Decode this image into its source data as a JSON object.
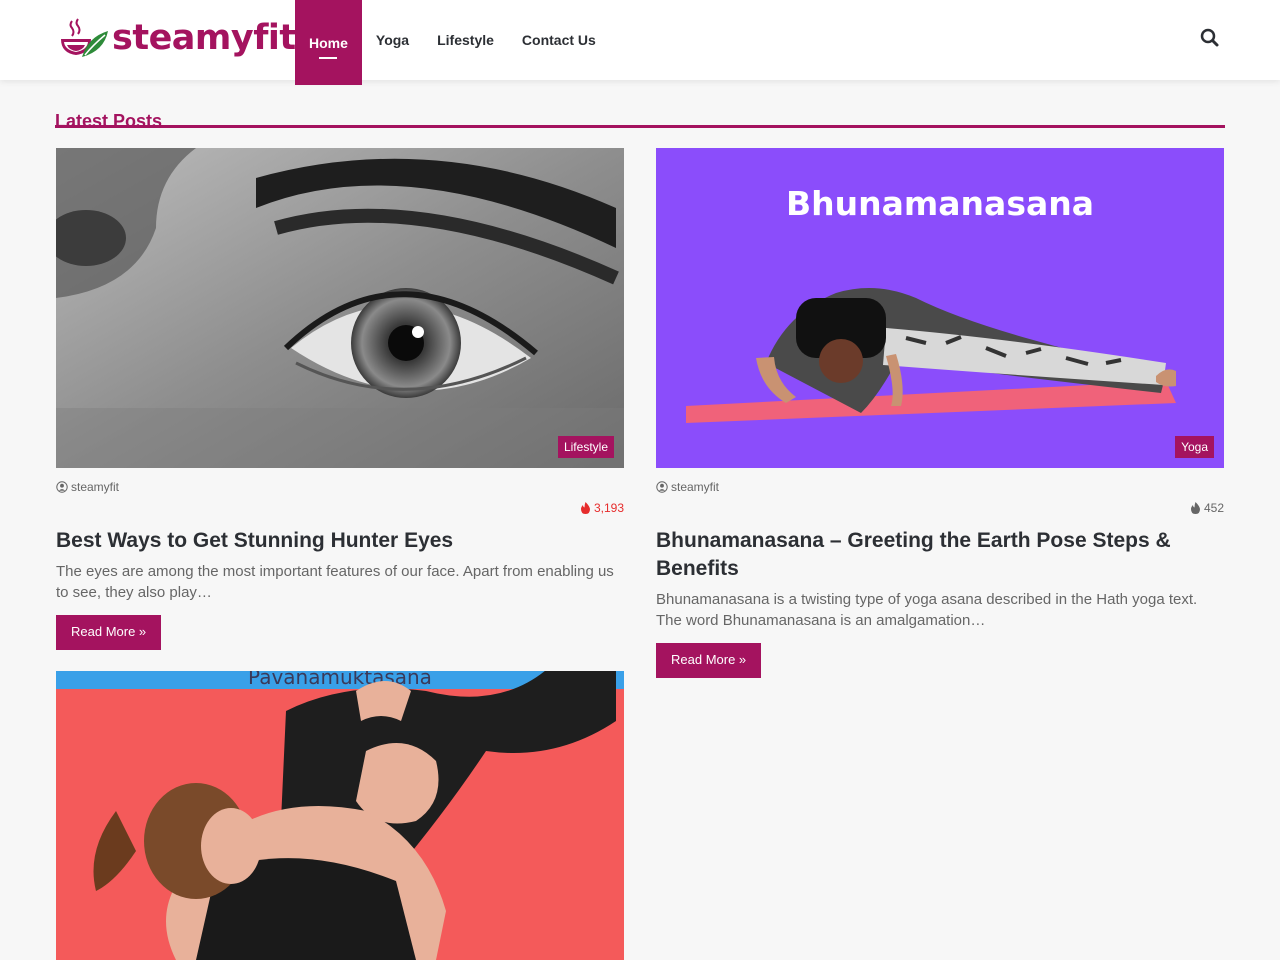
{
  "brand": {
    "name": "steamyfit",
    "accent": "#a4135f",
    "leaf_color": "#2e8b3a"
  },
  "nav": {
    "items": [
      {
        "label": "Home",
        "active": true
      },
      {
        "label": "Yoga",
        "active": false
      },
      {
        "label": "Lifestyle",
        "active": false
      },
      {
        "label": "Contact Us",
        "active": false
      }
    ],
    "search_icon": "search-icon"
  },
  "section": {
    "title": "Latest Posts"
  },
  "posts": [
    {
      "category": "Lifestyle",
      "author": "steamyfit",
      "views": "3,193",
      "views_hot": true,
      "title": "Best Ways to Get Stunning Hunter Eyes",
      "excerpt": "The eyes are among the most important features of our face. Apart from enabling us to see, they also play…",
      "read_more": "Read More »"
    },
    {
      "category": "Yoga",
      "author": "steamyfit",
      "views": "452",
      "views_hot": false,
      "title": "Bhunamanasana – Greeting the Earth Pose Steps & Benefits",
      "excerpt": "Bhunamanasana is a twisting type of yoga asana described in the Hath yoga text. The word Bhunamanasana is an amalgamation…",
      "read_more": "Read More »",
      "image_text": "Bhunamanasana"
    },
    {
      "image_text": "Pavanamuktasana"
    }
  ]
}
